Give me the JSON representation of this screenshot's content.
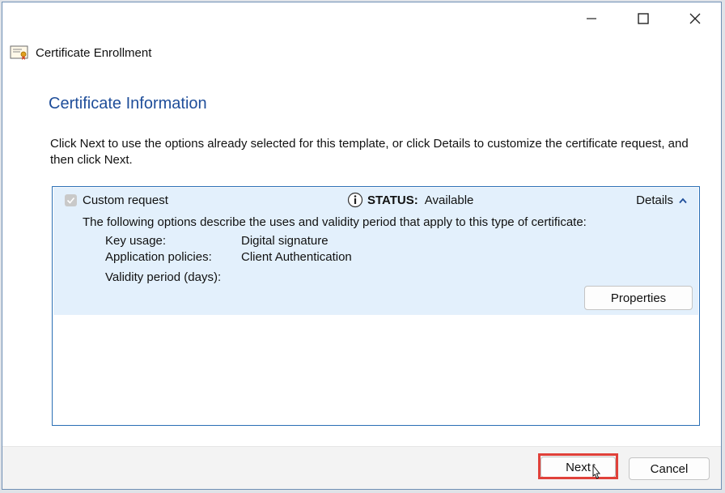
{
  "window": {
    "title": "Certificate Enrollment",
    "icons": [
      "certificate-icon",
      "minimize-icon",
      "maximize-icon",
      "close-icon"
    ]
  },
  "page": {
    "heading": "Certificate Information",
    "instructions": "Click Next to use the options already selected for this template, or click Details to customize the certificate request, and then click Next."
  },
  "request": {
    "checked": true,
    "name": "Custom request",
    "status_label": "STATUS:",
    "status_value": "Available",
    "details_label": "Details",
    "description": "The following options describe the uses and validity period that apply to this type of certificate:",
    "key_usage_label": "Key usage:",
    "key_usage_value": "Digital signature",
    "app_policies_label": "Application policies:",
    "app_policies_value": "Client Authentication",
    "validity_label": "Validity period (days):",
    "properties_button": "Properties"
  },
  "footer": {
    "next_button": "Next",
    "cancel_button": "Cancel"
  },
  "colors": {
    "heading": "#1f4e9a",
    "item_bg": "#e3f0fc",
    "list_border": "#2a6fb5",
    "highlight": "#e0413a"
  }
}
